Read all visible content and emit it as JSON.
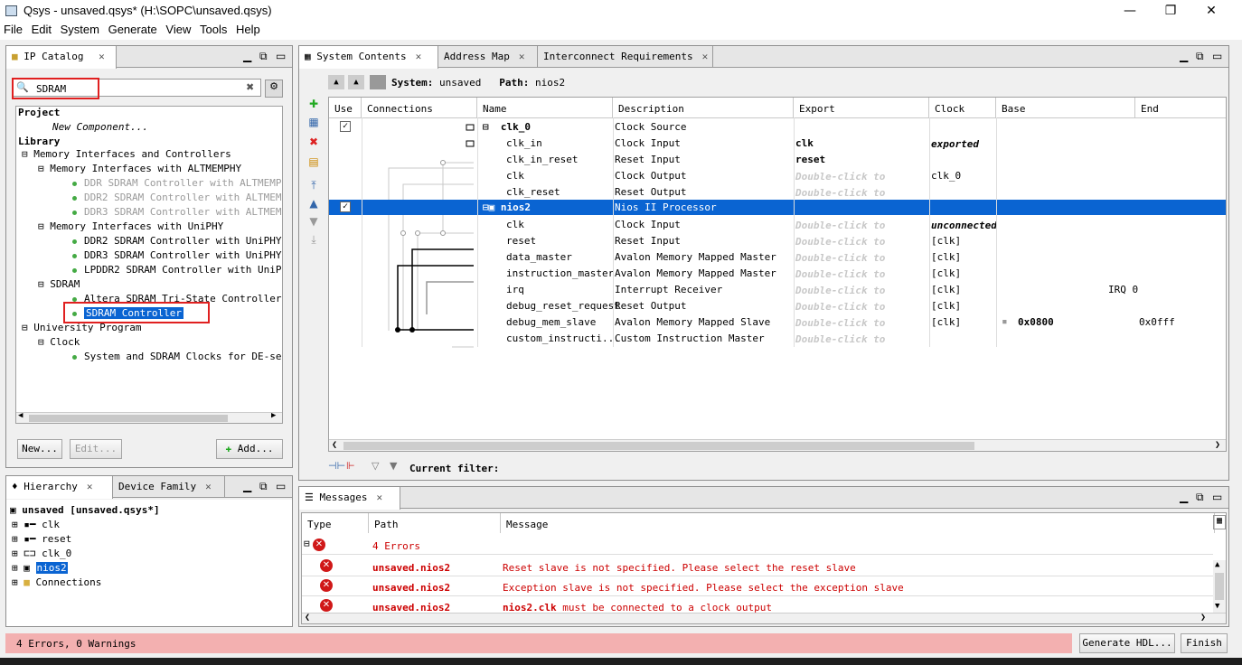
{
  "window": {
    "title": "Qsys - unsaved.qsys* (H:\\SOPC\\unsaved.qsys)",
    "controls": {
      "minimize": "—",
      "maximize": "❐",
      "close": "✕"
    }
  },
  "menu": [
    "File",
    "Edit",
    "System",
    "Generate",
    "View",
    "Tools",
    "Help"
  ],
  "ip_catalog": {
    "tab_label": "IP Catalog",
    "search_value": "SDRAM",
    "tree": [
      {
        "text": "Project",
        "bold": true
      },
      {
        "text": "New Component...",
        "italic": true
      },
      {
        "text": "Library",
        "bold": true
      },
      {
        "text": "Memory Interfaces and Controllers"
      },
      {
        "text": "Memory Interfaces with ALTMEMPHY"
      },
      {
        "text": "DDR SDRAM Controller with ALTMEMPHY",
        "gray": true
      },
      {
        "text": "DDR2 SDRAM Controller with ALTMEMPHY",
        "gray": true
      },
      {
        "text": "DDR3 SDRAM Controller with ALTMEMPHY",
        "gray": true
      },
      {
        "text": "Memory Interfaces with UniPHY"
      },
      {
        "text": "DDR2 SDRAM Controller with UniPHY"
      },
      {
        "text": "DDR3 SDRAM Controller with UniPHY"
      },
      {
        "text": "LPDDR2 SDRAM Controller with UniPHY"
      },
      {
        "text": "SDRAM"
      },
      {
        "text": "Altera SDRAM Tri-State Controller"
      },
      {
        "text": "SDRAM Controller",
        "selected": true
      },
      {
        "text": "University Program"
      },
      {
        "text": "Clock"
      },
      {
        "text": "System and SDRAM Clocks for DE-series"
      }
    ],
    "buttons": {
      "new": "New...",
      "edit": "Edit...",
      "add": "Add..."
    }
  },
  "hierarchy": {
    "tabs": [
      "Hierarchy",
      "Device Family"
    ],
    "items": [
      {
        "text": "unsaved [unsaved.qsys*]",
        "bold": true
      },
      {
        "text": "clk"
      },
      {
        "text": "reset"
      },
      {
        "text": "clk_0"
      },
      {
        "text": "nios2",
        "selected": true
      },
      {
        "text": "Connections"
      }
    ]
  },
  "system_contents": {
    "tabs": [
      "System Contents",
      "Address Map",
      "Interconnect Requirements"
    ],
    "system_label": "System:",
    "system_value": "unsaved",
    "path_label": "Path:",
    "path_value": "nios2",
    "columns": [
      "Use",
      "Connections",
      "Name",
      "Description",
      "Export",
      "Clock",
      "Base",
      "End"
    ],
    "rows": [
      {
        "use": true,
        "name": "clk_0",
        "desc": "Clock Source",
        "export": "",
        "clock": "",
        "base": "",
        "end": "",
        "group": true
      },
      {
        "name": "clk_in",
        "desc": "Clock Input",
        "export": "clk",
        "clock": "exported",
        "base": "",
        "end": ""
      },
      {
        "name": "clk_in_reset",
        "desc": "Reset Input",
        "export": "reset",
        "clock": "",
        "base": "",
        "end": ""
      },
      {
        "name": "clk",
        "desc": "Clock Output",
        "export": "Double-click to",
        "clock": "clk_0",
        "base": "",
        "end": ""
      },
      {
        "name": "clk_reset",
        "desc": "Reset Output",
        "export": "Double-click to",
        "clock": "",
        "base": "",
        "end": ""
      },
      {
        "use": true,
        "name": "nios2",
        "desc": "Nios II Processor",
        "export": "",
        "clock": "",
        "base": "",
        "end": "",
        "group": true,
        "selected": true
      },
      {
        "name": "clk",
        "desc": "Clock Input",
        "export": "Double-click to",
        "clock": "unconnected",
        "base": "",
        "end": ""
      },
      {
        "name": "reset",
        "desc": "Reset Input",
        "export": "Double-click to",
        "clock": "[clk]",
        "base": "",
        "end": ""
      },
      {
        "name": "data_master",
        "desc": "Avalon Memory Mapped Master",
        "export": "Double-click to",
        "clock": "[clk]",
        "base": "",
        "end": ""
      },
      {
        "name": "instruction_master",
        "desc": "Avalon Memory Mapped Master",
        "export": "Double-click to",
        "clock": "[clk]",
        "base": "",
        "end": ""
      },
      {
        "name": "irq",
        "desc": "Interrupt Receiver",
        "export": "Double-click to",
        "clock": "[clk]",
        "base": "IRQ 0",
        "end": ""
      },
      {
        "name": "debug_reset_request",
        "desc": "Reset Output",
        "export": "Double-click to",
        "clock": "[clk]",
        "base": "",
        "end": ""
      },
      {
        "name": "debug_mem_slave",
        "desc": "Avalon Memory Mapped Slave",
        "export": "Double-click to",
        "clock": "[clk]",
        "base": "0x0800",
        "end": "0x0fff"
      },
      {
        "name": "custom_instructi...",
        "desc": "Custom Instruction Master",
        "export": "Double-click to",
        "clock": "",
        "base": "",
        "end": ""
      }
    ],
    "filter_label": "Current filter:"
  },
  "messages": {
    "tab_label": "Messages",
    "columns": [
      "Type",
      "Path",
      "Message"
    ],
    "summary": "4 Errors",
    "rows": [
      {
        "path": "unsaved.nios2",
        "msg": "Reset slave is not specified. Please select the reset slave"
      },
      {
        "path": "unsaved.nios2",
        "msg": "Exception slave is not specified. Please select the exception slave"
      },
      {
        "path": "unsaved.nios2",
        "msg_bold": "nios2.clk",
        "msg": " must be connected to a clock output"
      }
    ]
  },
  "status": {
    "text": "4 Errors, 0 Warnings",
    "generate": "Generate HDL...",
    "finish": "Finish"
  },
  "colors": {
    "selection": "#0a64d2",
    "error_bar": "#f3b0b0",
    "error": "#cc0000",
    "highlight_box": "#e02020"
  }
}
